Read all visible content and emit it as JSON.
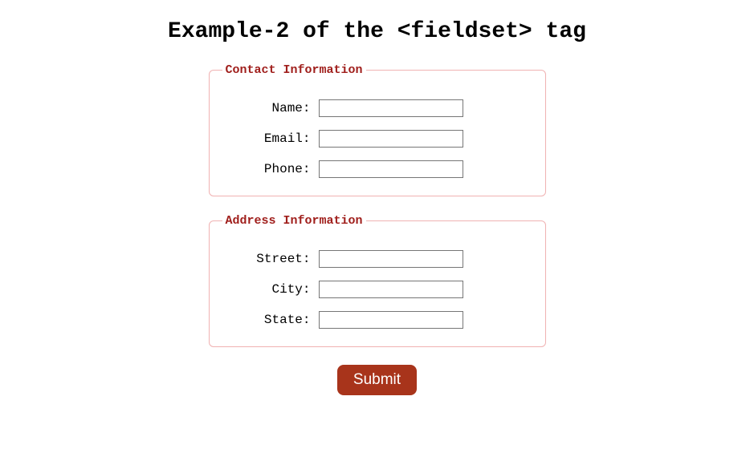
{
  "heading": "Example-2 of the <fieldset> tag",
  "groups": [
    {
      "legend": "Contact Information",
      "name": "contact-information",
      "fields": [
        {
          "label": "Name:",
          "name": "name-field",
          "value": ""
        },
        {
          "label": "Email:",
          "name": "email-field",
          "value": ""
        },
        {
          "label": "Phone:",
          "name": "phone-field",
          "value": ""
        }
      ]
    },
    {
      "legend": "Address Information",
      "name": "address-information",
      "fields": [
        {
          "label": "Street:",
          "name": "street-field",
          "value": ""
        },
        {
          "label": "City:",
          "name": "city-field",
          "value": ""
        },
        {
          "label": "State:",
          "name": "state-field",
          "value": ""
        }
      ]
    }
  ],
  "submit_label": "Submit"
}
